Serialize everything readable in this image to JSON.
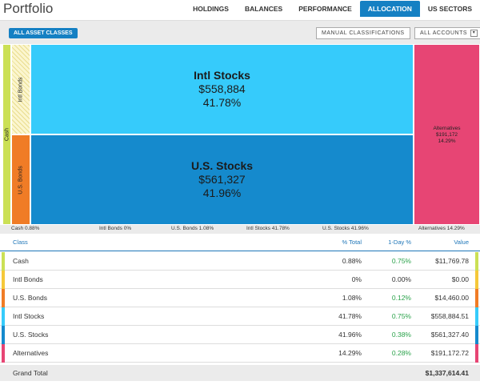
{
  "app": {
    "title": "Portfolio"
  },
  "nav": {
    "tabs": [
      {
        "label": "HOLDINGS"
      },
      {
        "label": "BALANCES"
      },
      {
        "label": "PERFORMANCE"
      },
      {
        "label": "ALLOCATION",
        "active": true
      },
      {
        "label": "US SECTORS"
      }
    ]
  },
  "toolbar": {
    "all_asset_classes": "ALL ASSET CLASSES",
    "manual_classifications": "MANUAL CLASSIFICATIONS",
    "all_accounts": "ALL ACCOUNTS",
    "accounts_caret": "▾"
  },
  "treemap": {
    "cash": {
      "name": "Cash",
      "color": "#cbe055"
    },
    "intl_bonds": {
      "name": "Intl Bonds",
      "color": "#fbf6cf"
    },
    "us_bonds": {
      "name": "U.S. Bonds",
      "color": "#f07c26"
    },
    "intl_stocks": {
      "name": "Intl Stocks",
      "value": "$558,884",
      "pct": "41.78%",
      "color": "#36cbfb"
    },
    "us_stocks": {
      "name": "U.S. Stocks",
      "value": "$561,327",
      "pct": "41.96%",
      "color": "#158acd"
    },
    "alternatives": {
      "name": "Alternatives",
      "value": "$191,172",
      "pct": "14.29%",
      "color": "#e74574"
    }
  },
  "legend": {
    "cash": "Cash 0.88%",
    "intl_bonds": "Intl Bonds 0%",
    "us_bonds": "U.S. Bonds 1.08%",
    "intl_stocks": "Intl Stocks 41.78%",
    "us_stocks": "U.S. Stocks 41.96%",
    "alternatives": "Alternatives 14.29%"
  },
  "table": {
    "headers": {
      "class": "Class",
      "pct_total": "% Total",
      "one_day": "1-Day %",
      "value": "Value"
    },
    "rows": [
      {
        "name": "Cash",
        "pct": "0.88%",
        "day": "0.75%",
        "value": "$11,769.78",
        "color": "#cbe055"
      },
      {
        "name": "Intl Bonds",
        "pct": "0%",
        "day": "0.00%",
        "value": "$0.00",
        "color": "#f5c83a"
      },
      {
        "name": "U.S. Bonds",
        "pct": "1.08%",
        "day": "0.12%",
        "value": "$14,460.00",
        "color": "#f07c26"
      },
      {
        "name": "Intl Stocks",
        "pct": "41.78%",
        "day": "0.75%",
        "value": "$558,884.51",
        "color": "#36cbfb"
      },
      {
        "name": "U.S. Stocks",
        "pct": "41.96%",
        "day": "0.38%",
        "value": "$561,327.40",
        "color": "#158acd"
      },
      {
        "name": "Alternatives",
        "pct": "14.29%",
        "day": "0.28%",
        "value": "$191,172.72",
        "color": "#e74574"
      }
    ],
    "grand_total": {
      "label": "Grand Total",
      "value": "$1,337,614.41"
    }
  }
}
